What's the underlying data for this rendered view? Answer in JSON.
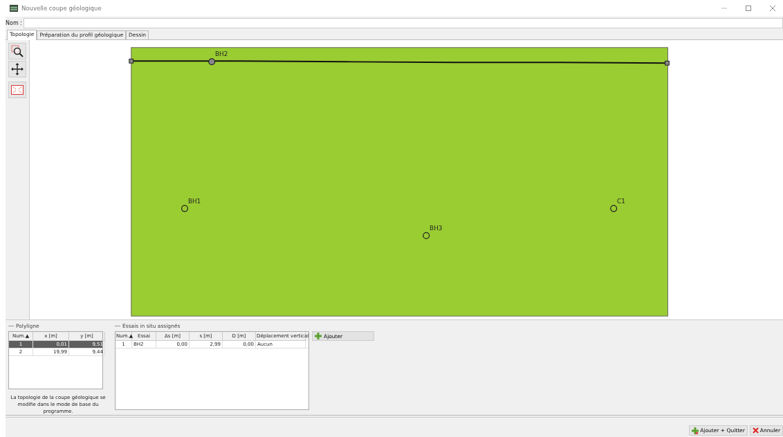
{
  "window": {
    "title": "Nouvelle coupe géologique"
  },
  "name_field": {
    "label": "Nom :"
  },
  "tabs": [
    {
      "label": "Topologie",
      "selected": true
    },
    {
      "label": "Préparation du profil géologique",
      "selected": false
    },
    {
      "label": "Dessin",
      "selected": false
    }
  ],
  "canvas": {
    "boreholes": [
      {
        "label": "BH2",
        "assigned": true
      },
      {
        "label": "BH1",
        "assigned": false
      },
      {
        "label": "C1",
        "assigned": false
      },
      {
        "label": "BH3",
        "assigned": false
      }
    ]
  },
  "polyline": {
    "title": "Polyligne",
    "columns": [
      "Num.▲",
      "x [m]",
      "y [m]"
    ],
    "rows": [
      {
        "cells": [
          "1",
          "0,01",
          "9,51"
        ],
        "selected": true
      },
      {
        "cells": [
          "2",
          "19,99",
          "9,44"
        ],
        "selected": false
      }
    ],
    "note": "La topologie de la coupe géologique se modifie dans le mode de base du programme."
  },
  "tests": {
    "title": "Essais in situ assignés",
    "columns": [
      "Num.▲",
      "Essai",
      "Δs [m]",
      "s [m]",
      "D [m]",
      "Déplacement vertical"
    ],
    "rows": [
      {
        "cells": [
          "1",
          "BH2",
          "0,00",
          "2,99",
          "0,00",
          "Aucun"
        ],
        "selected": false
      }
    ],
    "add_button": "Ajouter"
  },
  "footer": {
    "buttons": [
      {
        "label": "Ajouter + Quitter",
        "kind": "confirm"
      },
      {
        "label": "Annuler",
        "kind": "cancel"
      }
    ]
  }
}
